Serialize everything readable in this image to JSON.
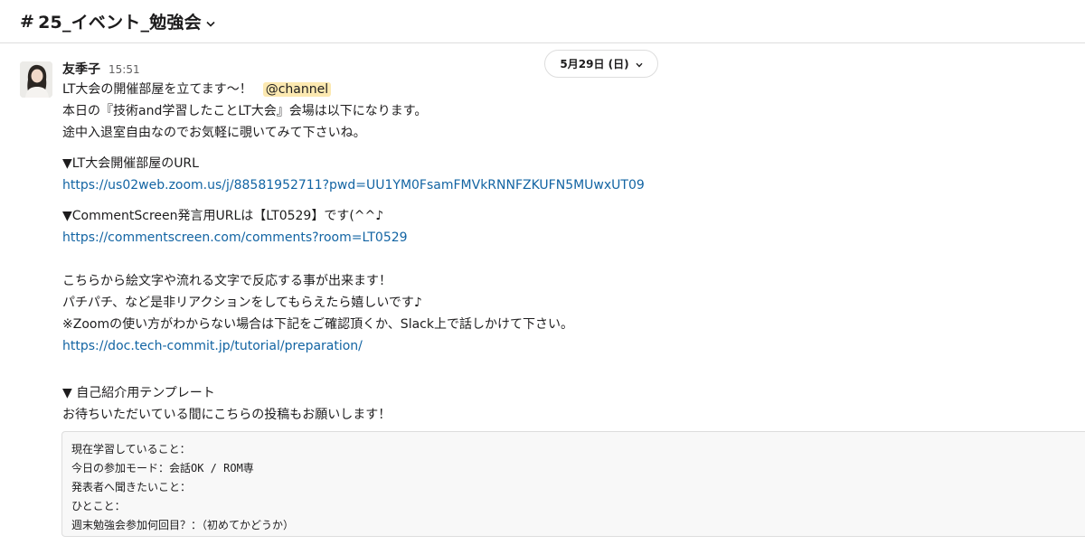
{
  "header": {
    "hash_symbol": "#",
    "channel_name": "25_イベント_勉強会"
  },
  "date_divider": {
    "label": "5月29日 (日)"
  },
  "message": {
    "author": "友季子",
    "time": "15:51",
    "lines": {
      "l1": "LT大会の開催部屋を立てます〜！",
      "mention": "@channel",
      "l2": "本日の『技術and学習したことLT大会』会場は以下になります。",
      "l3": "途中入退室自由なのでお気軽に覗いてみて下さいね。",
      "l4": "▼LT大会開催部屋のURL",
      "link1": "https://us02web.zoom.us/j/88581952711?pwd=UU1YM0FsamFMVkRNNFZKUFN5MUwxUT09",
      "l5": "▼CommentScreen発言用URLは【LT0529】です(^^♪",
      "link2": "https://commentscreen.com/comments?room=LT0529",
      "l6": "こちらから絵文字や流れる文字で反応する事が出来ます！",
      "l7": "パチパチ、など是非リアクションをしてもらえたら嬉しいです♪",
      "l8": "※Zoomの使い方がわからない場合は下記をご確認頂くか、Slack上で話しかけて下さい。",
      "link3": "https://doc.tech-commit.jp/tutorial/preparation/",
      "l9": "▼ 自己紹介用テンプレート",
      "l10": "お待ちいただいている間にこちらの投稿もお願いします！"
    },
    "code_block": [
      "現在学習していること：",
      "今日の参加モード：会話OK / ROM専",
      "発表者へ聞きたいこと：",
      "ひとこと：",
      "週末勉強会参加何回目？：（初めてかどうか）"
    ]
  },
  "icons": {
    "channel_dropdown": "chevron-down-icon",
    "date_dropdown": "chevron-down-icon"
  },
  "colors": {
    "link": "#1264a3",
    "mention_bg": "#fce9b1",
    "text": "#1d1c1d",
    "timestamp": "#616061"
  }
}
